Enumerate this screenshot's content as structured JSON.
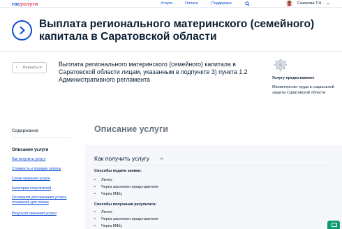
{
  "header": {
    "logo_part1": "гос",
    "logo_part2": "услуги",
    "nav": [
      "Услуги",
      "Оплата",
      "Поддержка"
    ],
    "user_name": "Сазонова Т.Н."
  },
  "hero": {
    "title": "Выплата регионального материнского (семейного) капитала в Саратовской области"
  },
  "back_button": {
    "label": "Вернуться"
  },
  "service_description": "Выплата регионального материнского (семейного) капитала в Саратовской области лицам, указанным в подпункте 3) пункта 1.2 Административного регламента",
  "provider": {
    "title": "Услугу предоставляет",
    "name": "Министерство труда и социальной защиты Саратовской области"
  },
  "toc": {
    "title": "Содержание",
    "active": "Описание услуги",
    "links": [
      "Как получить услугу",
      "Стоимость и порядок оплаты",
      "Сроки оказания услуги",
      "Категории получателей",
      "Основания для оказания услуги, основания для отказа",
      "Результат оказания услуги"
    ]
  },
  "main": {
    "section_title": "Описание услуги",
    "accordion_title": "Как получить услугу",
    "submit_heading": "Способы подачи заявки:",
    "submit_methods": [
      "Лично",
      "Через законного представителя",
      "Через МФЦ"
    ],
    "result_heading": "Способы получения результата:",
    "result_methods": [
      "Лично",
      "Через законного представителя",
      "Через МФЦ"
    ]
  },
  "colors": {
    "brand_blue": "#0d4cd3",
    "brand_red": "#ee3f58",
    "text": "#0b1f33",
    "muted": "#66727f"
  },
  "icons": [
    "search-icon",
    "chevron-down-icon",
    "chevron-right-icon",
    "chevron-left-icon",
    "emblem-icon",
    "chevron-up-icon",
    "chat-icon"
  ]
}
